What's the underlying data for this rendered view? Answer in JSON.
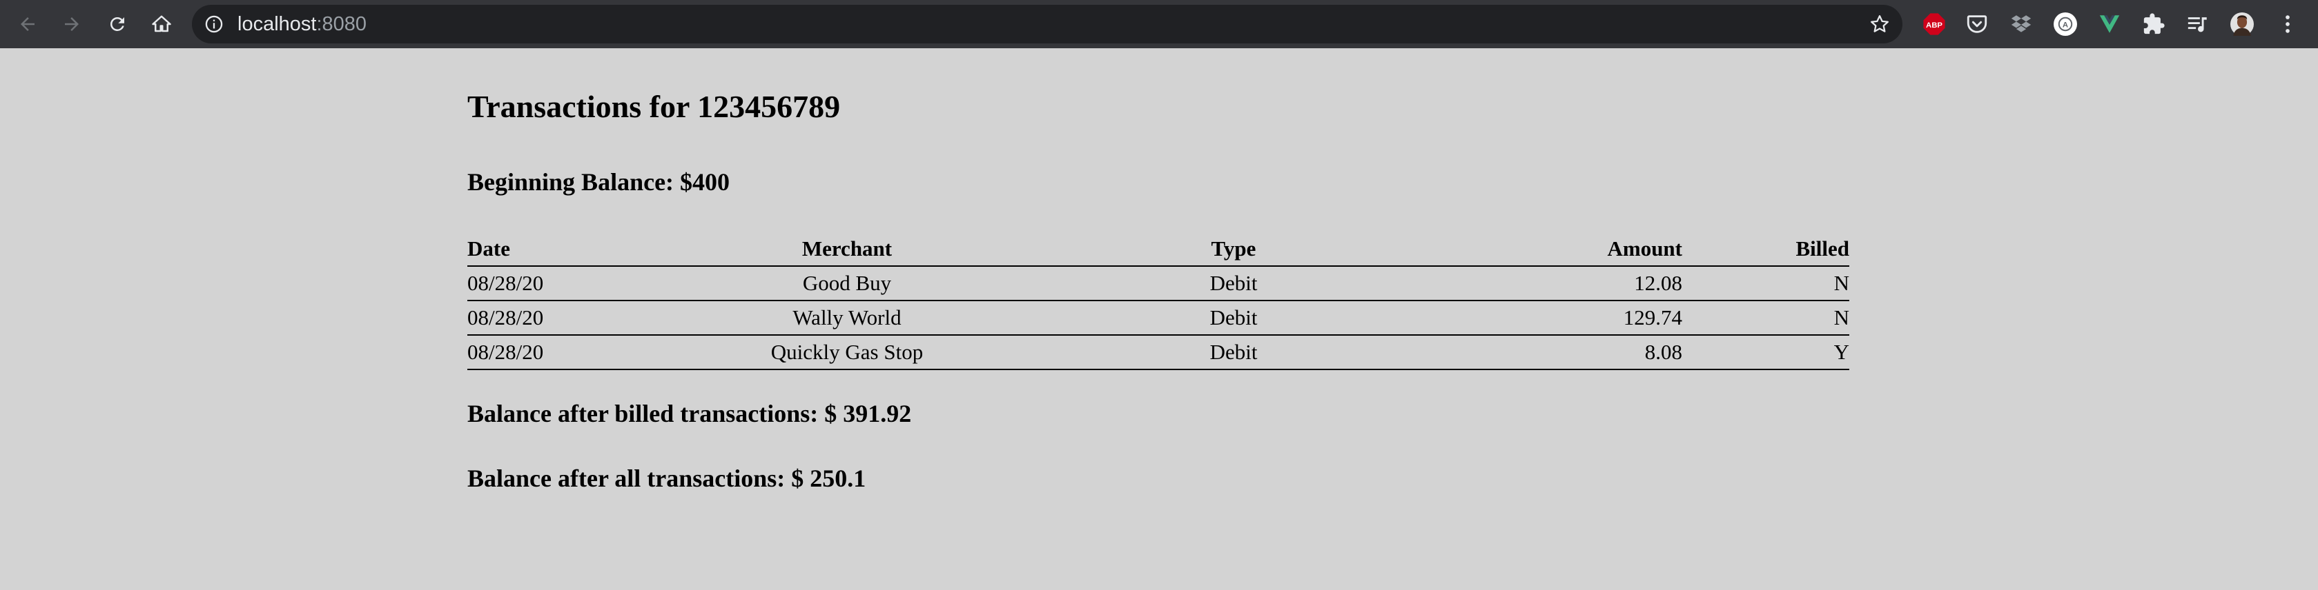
{
  "browser": {
    "url_host": "localhost",
    "url_port": ":8080",
    "icons": {
      "back": "arrow-left-icon",
      "forward": "arrow-right-icon",
      "reload": "reload-icon",
      "home": "home-icon",
      "info": "info-icon",
      "bookmark": "star-icon"
    },
    "extensions": [
      {
        "name": "adblock-plus-icon",
        "label": "ABP"
      },
      {
        "name": "pocket-icon"
      },
      {
        "name": "dropbox-icon"
      },
      {
        "name": "profile-a-icon",
        "label": "A"
      },
      {
        "name": "vue-devtools-icon"
      },
      {
        "name": "extensions-puzzle-icon"
      },
      {
        "name": "media-queue-icon"
      },
      {
        "name": "user-avatar"
      },
      {
        "name": "kebab-menu-icon"
      }
    ]
  },
  "page": {
    "title": "Transactions for 123456789",
    "beginning_balance": "Beginning Balance: $400",
    "table": {
      "headers": {
        "date": "Date",
        "merchant": "Merchant",
        "type": "Type",
        "amount": "Amount",
        "billed": "Billed"
      },
      "rows": [
        {
          "date": "08/28/20",
          "merchant": "Good Buy",
          "type": "Debit",
          "amount": "12.08",
          "billed": "N"
        },
        {
          "date": "08/28/20",
          "merchant": "Wally World",
          "type": "Debit",
          "amount": "129.74",
          "billed": "N"
        },
        {
          "date": "08/28/20",
          "merchant": "Quickly Gas Stop",
          "type": "Debit",
          "amount": "8.08",
          "billed": "Y"
        }
      ]
    },
    "balance_billed": "Balance after billed transactions: $ 391.92",
    "balance_all": "Balance after all transactions: $ 250.1"
  },
  "colors": {
    "page_background": "#d3d3d3",
    "chrome_background": "#35363a",
    "omnibox_background": "#202124",
    "abp_red": "#d0021b",
    "vue_green": "#41b883"
  }
}
